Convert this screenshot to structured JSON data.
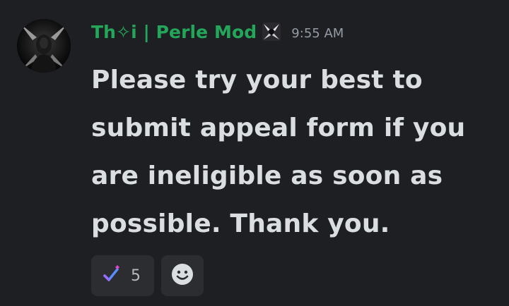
{
  "message": {
    "author": "Th✧i | Perle Mod",
    "timestamp": "9:55 AM",
    "text": "Please try your best to submit appeal form if you are ineligible as soon as possible. Thank you."
  },
  "icons": {
    "avatar": "hooded-figure-avatar",
    "badge": "mod-badge-icon",
    "reaction_emoji": "checkmark-sparkle-icon",
    "add_reaction": "smiley-face-icon"
  },
  "reactions": [
    {
      "count": "5"
    }
  ],
  "colors": {
    "background": "#1e1f22",
    "username": "#23a55a",
    "message_text": "#dbdee1",
    "timestamp": "#949ba4",
    "reaction_bg": "#2b2d31"
  }
}
